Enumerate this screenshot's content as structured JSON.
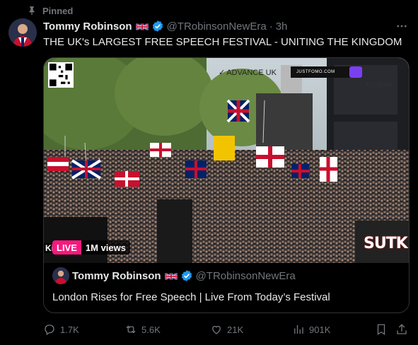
{
  "pinned_label": "Pinned",
  "author": {
    "name": "Tommy Robinson",
    "handle": "@TRobinsonNewEra",
    "time": "3h"
  },
  "tweet_text": "THE UK's LARGEST FREE SPEECH FESTIVAL - UNITING THE KINGDOM",
  "media": {
    "overlay_brand": "ADVANCE UK",
    "overlay_site": "JUSTFOMO.COM",
    "overlay_athena": "ATHENA",
    "overlay_sutk": "SUTK",
    "ticker_fragment": "Ki",
    "live_label": "LIVE",
    "views_label": "1M views"
  },
  "quote": {
    "name": "Tommy Robinson",
    "handle": "@TRobinsonNewEra",
    "text": "London Rises for Free Speech | Live From Today’s Festival"
  },
  "actions": {
    "replies": "1.7K",
    "reposts": "5.6K",
    "likes": "21K",
    "views": "901K"
  },
  "colors": {
    "background": "#000000",
    "text": "#e7e9ea",
    "muted": "#71767b",
    "verified": "#1d9bf0",
    "live": "#f91880",
    "border": "#2f3336"
  }
}
